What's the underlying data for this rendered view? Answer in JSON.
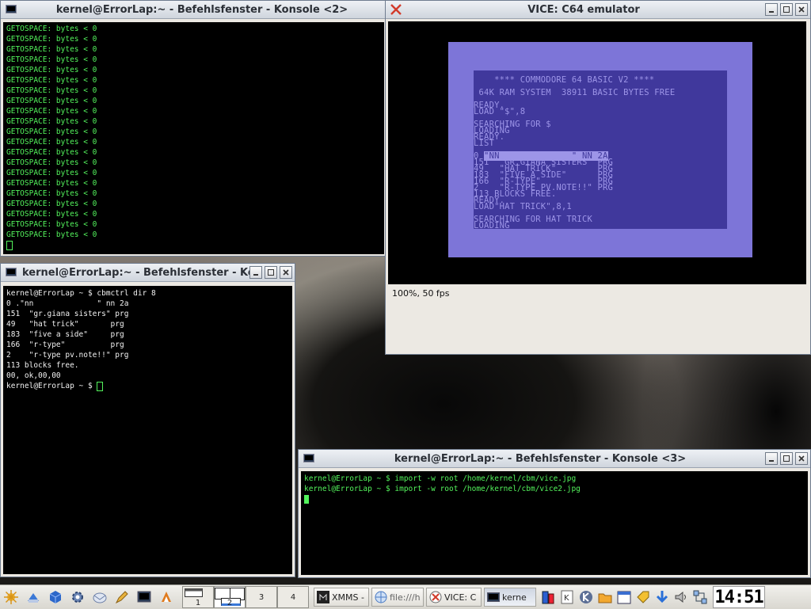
{
  "konsole2": {
    "title": "kernel@ErrorLap:~ - Befehlsfenster - Konsole <2>",
    "lines": [
      "GETOSPACE: bytes < 0",
      "GETOSPACE: bytes < 0",
      "GETOSPACE: bytes < 0",
      "GETOSPACE: bytes < 0",
      "GETOSPACE: bytes < 0",
      "GETOSPACE: bytes < 0",
      "GETOSPACE: bytes < 0",
      "GETOSPACE: bytes < 0",
      "GETOSPACE: bytes < 0",
      "GETOSPACE: bytes < 0",
      "GETOSPACE: bytes < 0",
      "GETOSPACE: bytes < 0",
      "GETOSPACE: bytes < 0",
      "GETOSPACE: bytes < 0",
      "GETOSPACE: bytes < 0",
      "GETOSPACE: bytes < 0",
      "GETOSPACE: bytes < 0",
      "GETOSPACE: bytes < 0",
      "GETOSPACE: bytes < 0",
      "GETOSPACE: bytes < 0",
      "GETOSPACE: bytes < 0"
    ]
  },
  "konsole_left": {
    "title": "kernel@ErrorLap:~ - Befehlsfenster - Ko",
    "prompt": "kernel@ErrorLap ~ $ ",
    "command": "cbmctrl dir 8",
    "output": [
      "0 .\"nn              \" nn 2a",
      "151  \"gr.giana sisters\" prg",
      "49   \"hat trick\"       prg",
      "183  \"five a side\"     prg",
      "166  \"r-type\"          prg",
      "2    \"r-type pv.note!!\" prg",
      "113 blocks free.",
      "00, ok,00,00"
    ]
  },
  "konsole3": {
    "title": "kernel@ErrorLap:~ - Befehlsfenster - Konsole <3>",
    "prompt": "kernel@ErrorLap ~ $ ",
    "commands": [
      "import -w root /home/kernel/cbm/vice.jpg",
      "import -w root /home/kernel/cbm/vice2.jpg"
    ]
  },
  "vice": {
    "title": "VICE: C64 emulator",
    "status": "100%, 50 fps",
    "screen": {
      "l01": "    **** COMMODORE 64 BASIC V2 ****",
      "l03": " 64K RAM SYSTEM  38911 BASIC BYTES FREE",
      "l05": "READY.",
      "l06": "LOAD \"$\",8",
      "l08": "SEARCHING FOR $",
      "l09": "LOADING",
      "l10": "READY.",
      "l11": "LIST",
      "l13a": "0 ",
      "l13b": "\"NN              \" NN 2A",
      "l14": "151  \"GR.GIANA SISTERS\" PRG",
      "l15": "49   \"HAT TRICK\"        PRG",
      "l16": "183  \"FIVE A SIDE\"      PRG",
      "l17": "166  \"R-TYPE\"           PRG",
      "l18": "2    \"R-TYPE PV.NOTE!!\" PRG",
      "l19": "113 BLOCKS FREE.",
      "l20": "READY.",
      "l21": "LOAD\"HAT TRICK\",8,1",
      "l23": "SEARCHING FOR HAT TRICK",
      "l24": "LOADING"
    }
  },
  "taskbar": {
    "desktops": [
      "1",
      "2",
      "3",
      "4"
    ],
    "tasks": [
      "XMMS -",
      "file:///h",
      "VICE: C",
      "kerne"
    ],
    "clock": "14:51"
  },
  "colors": {
    "terminal_fg": "#53f35c",
    "c64_bg": "#40389c",
    "c64_border": "#7d75d8",
    "c64_text": "#9d95e8"
  }
}
